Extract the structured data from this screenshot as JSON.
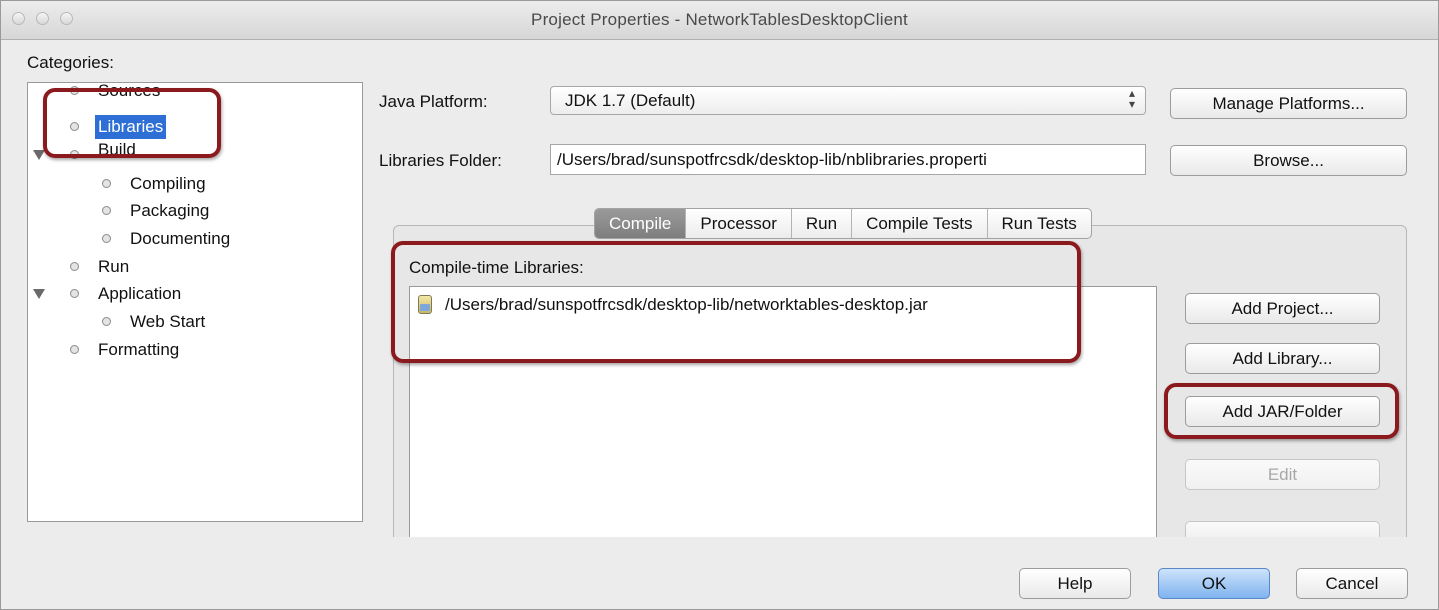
{
  "window": {
    "title": "Project Properties - NetworkTablesDesktopClient"
  },
  "categories": {
    "label": "Categories:",
    "items": [
      {
        "label": "Sources"
      },
      {
        "label": "Libraries",
        "selected": true
      },
      {
        "label": "Build",
        "expanded": true
      },
      {
        "label": "Compiling"
      },
      {
        "label": "Packaging"
      },
      {
        "label": "Documenting"
      },
      {
        "label": "Run"
      },
      {
        "label": "Application",
        "expanded": true
      },
      {
        "label": "Web Start"
      },
      {
        "label": "Formatting"
      }
    ]
  },
  "java_platform": {
    "label": "Java Platform:",
    "value": "JDK 1.7 (Default)",
    "manage_button": "Manage Platforms..."
  },
  "libraries_folder": {
    "label": "Libraries Folder:",
    "value": "/Users/brad/sunspotfrcsdk/desktop-lib/nblibraries.properti",
    "browse_button": "Browse..."
  },
  "tabs": [
    {
      "label": "Compile",
      "active": true
    },
    {
      "label": "Processor"
    },
    {
      "label": "Run"
    },
    {
      "label": "Compile Tests"
    },
    {
      "label": "Run Tests"
    }
  ],
  "compile_libraries": {
    "label": "Compile-time Libraries:",
    "items": [
      {
        "path": "/Users/brad/sunspotfrcsdk/desktop-lib/networktables-desktop.jar",
        "icon": "jar-icon"
      }
    ]
  },
  "side_buttons": {
    "add_project": "Add Project...",
    "add_library": "Add Library...",
    "add_jar_folder": "Add JAR/Folder",
    "edit": "Edit"
  },
  "footer": {
    "help": "Help",
    "ok": "OK",
    "cancel": "Cancel"
  },
  "colors": {
    "highlight": "#8b1a1f",
    "selection": "#2e6fd6",
    "default_button": "#7fb3ee"
  }
}
